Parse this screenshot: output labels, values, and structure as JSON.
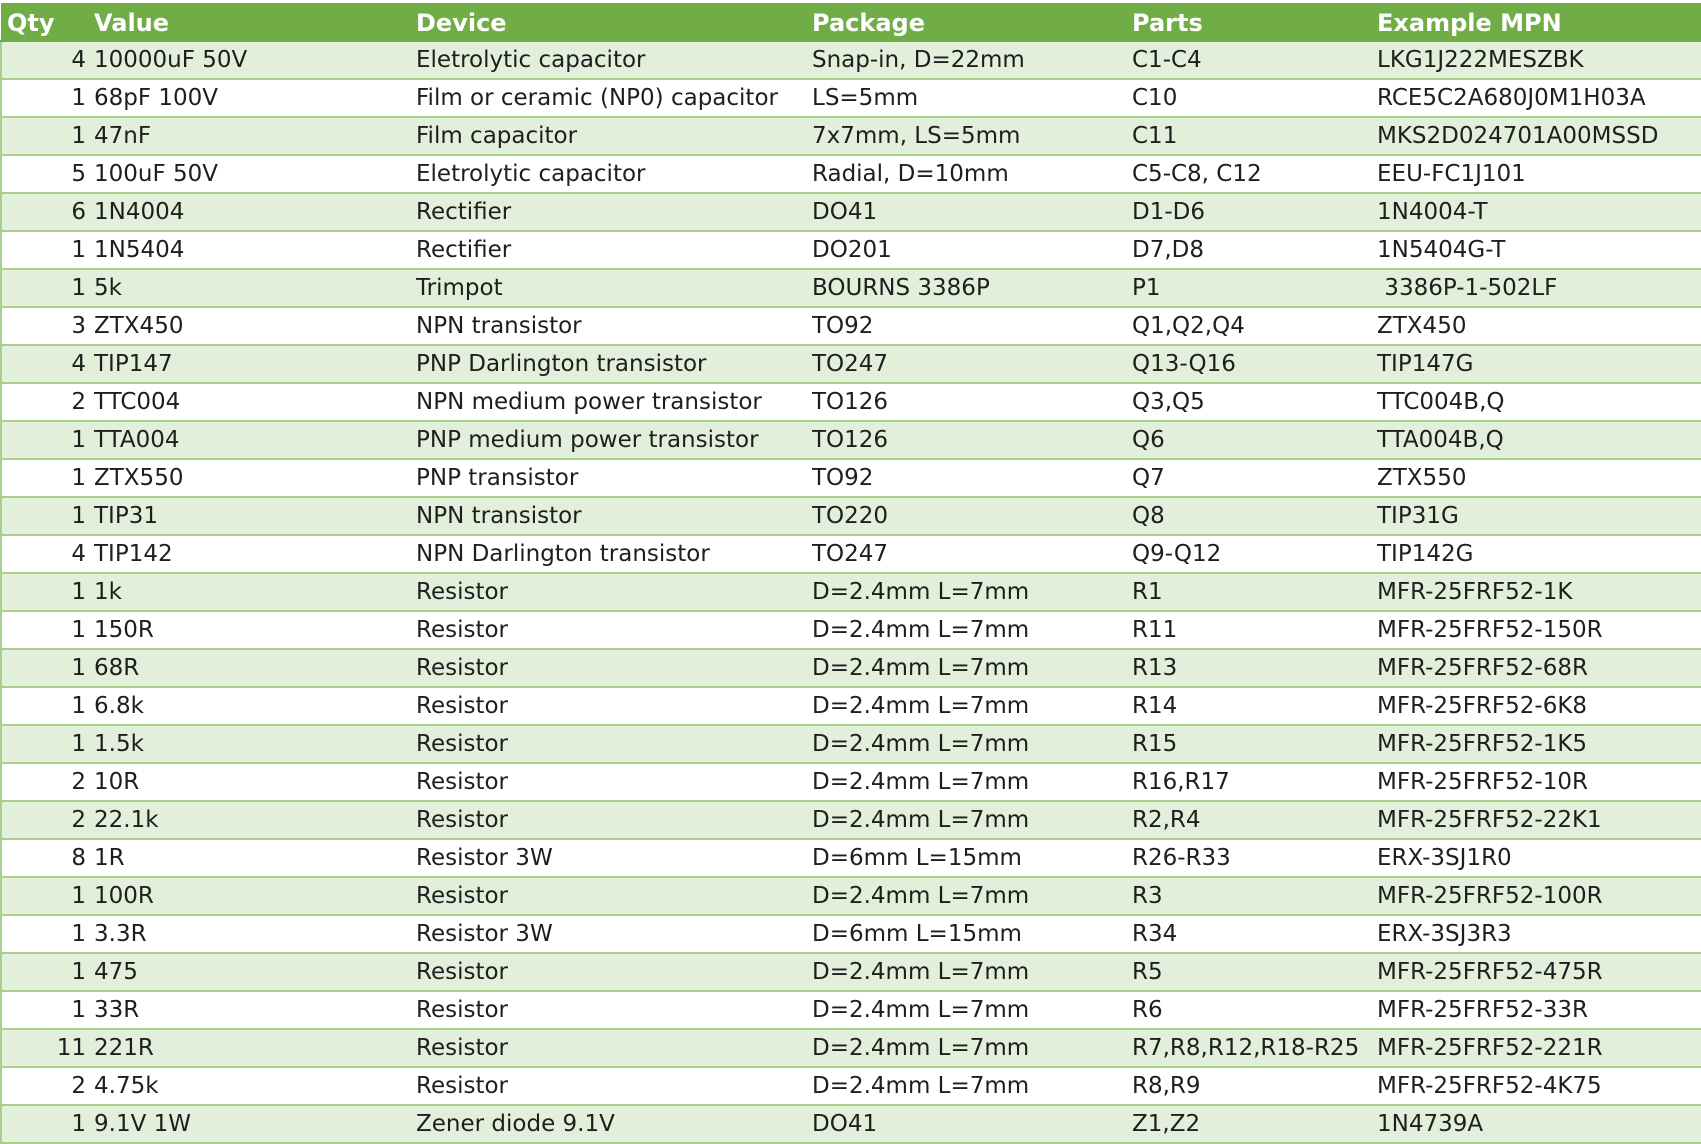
{
  "table": {
    "headers": {
      "qty": "Qty",
      "value": "Value",
      "device": "Device",
      "package": "Package",
      "parts": "Parts",
      "mpn": "Example MPN"
    },
    "rows": [
      {
        "qty": "4",
        "value": "10000uF 50V",
        "device": "Eletrolytic capacitor",
        "package": "Snap-in, D=22mm",
        "parts": "C1-C4",
        "mpn": "LKG1J222MESZBK"
      },
      {
        "qty": "1",
        "value": "68pF 100V",
        "device": "Film or ceramic (NP0) capacitor",
        "package": "LS=5mm",
        "parts": "C10",
        "mpn": "RCE5C2A680J0M1H03A"
      },
      {
        "qty": "1",
        "value": "47nF",
        "device": "Film capacitor",
        "package": "7x7mm, LS=5mm",
        "parts": "C11",
        "mpn": "MKS2D024701A00MSSD"
      },
      {
        "qty": "5",
        "value": "100uF 50V",
        "device": "Eletrolytic capacitor",
        "package": "Radial, D=10mm",
        "parts": "C5-C8, C12",
        "mpn": "EEU-FC1J101"
      },
      {
        "qty": "6",
        "value": "1N4004",
        "device": "Rectifier",
        "package": "DO41",
        "parts": "D1-D6",
        "mpn": "1N4004-T"
      },
      {
        "qty": "1",
        "value": "1N5404",
        "device": "Rectifier",
        "package": "DO201",
        "parts": "D7,D8",
        "mpn": "1N5404G-T"
      },
      {
        "qty": "1",
        "value": "5k",
        "device": "Trimpot",
        "package": "BOURNS 3386P",
        "parts": "P1",
        "mpn": " 3386P-1-502LF"
      },
      {
        "qty": "3",
        "value": "ZTX450",
        "device": "NPN transistor",
        "package": "TO92",
        "parts": "Q1,Q2,Q4",
        "mpn": "ZTX450"
      },
      {
        "qty": "4",
        "value": "TIP147",
        "device": "PNP Darlington transistor",
        "package": "TO247",
        "parts": "Q13-Q16",
        "mpn": "TIP147G"
      },
      {
        "qty": "2",
        "value": "TTC004",
        "device": "NPN medium power transistor",
        "package": "TO126",
        "parts": "Q3,Q5",
        "mpn": "TTC004B,Q"
      },
      {
        "qty": "1",
        "value": "TTA004",
        "device": "PNP medium power transistor",
        "package": "TO126",
        "parts": "Q6",
        "mpn": "TTA004B,Q"
      },
      {
        "qty": "1",
        "value": "ZTX550",
        "device": "PNP transistor",
        "package": "TO92",
        "parts": "Q7",
        "mpn": "ZTX550"
      },
      {
        "qty": "1",
        "value": "TIP31",
        "device": "NPN transistor",
        "package": "TO220",
        "parts": "Q8",
        "mpn": "TIP31G"
      },
      {
        "qty": "4",
        "value": "TIP142",
        "device": "NPN Darlington transistor",
        "package": "TO247",
        "parts": "Q9-Q12",
        "mpn": "TIP142G"
      },
      {
        "qty": "1",
        "value": "1k",
        "device": "Resistor",
        "package": "D=2.4mm L=7mm",
        "parts": "R1",
        "mpn": "MFR-25FRF52-1K"
      },
      {
        "qty": "1",
        "value": "150R",
        "device": "Resistor",
        "package": "D=2.4mm L=7mm",
        "parts": "R11",
        "mpn": "MFR-25FRF52-150R"
      },
      {
        "qty": "1",
        "value": "68R",
        "device": "Resistor",
        "package": "D=2.4mm L=7mm",
        "parts": "R13",
        "mpn": "MFR-25FRF52-68R"
      },
      {
        "qty": "1",
        "value": "6.8k",
        "device": "Resistor",
        "package": "D=2.4mm L=7mm",
        "parts": "R14",
        "mpn": "MFR-25FRF52-6K8"
      },
      {
        "qty": "1",
        "value": "1.5k",
        "device": "Resistor",
        "package": "D=2.4mm L=7mm",
        "parts": "R15",
        "mpn": "MFR-25FRF52-1K5"
      },
      {
        "qty": "2",
        "value": "10R",
        "device": "Resistor",
        "package": "D=2.4mm L=7mm",
        "parts": "R16,R17",
        "mpn": "MFR-25FRF52-10R"
      },
      {
        "qty": "2",
        "value": "22.1k",
        "device": "Resistor",
        "package": "D=2.4mm L=7mm",
        "parts": "R2,R4",
        "mpn": "MFR-25FRF52-22K1"
      },
      {
        "qty": "8",
        "value": "1R",
        "device": "Resistor 3W",
        "package": "D=6mm L=15mm",
        "parts": "R26-R33",
        "mpn": "ERX-3SJ1R0"
      },
      {
        "qty": "1",
        "value": "100R",
        "device": "Resistor",
        "package": "D=2.4mm L=7mm",
        "parts": "R3",
        "mpn": "MFR-25FRF52-100R"
      },
      {
        "qty": "1",
        "value": "3.3R",
        "device": "Resistor 3W",
        "package": "D=6mm L=15mm",
        "parts": "R34",
        "mpn": "ERX-3SJ3R3"
      },
      {
        "qty": "1",
        "value": "475",
        "device": "Resistor",
        "package": "D=2.4mm L=7mm",
        "parts": "R5",
        "mpn": "MFR-25FRF52-475R"
      },
      {
        "qty": "1",
        "value": "33R",
        "device": "Resistor",
        "package": "D=2.4mm L=7mm",
        "parts": "R6",
        "mpn": "MFR-25FRF52-33R"
      },
      {
        "qty": "11",
        "value": "221R",
        "device": "Resistor",
        "package": "D=2.4mm L=7mm",
        "parts": "R7,R8,R12,R18-R25",
        "mpn": "MFR-25FRF52-221R"
      },
      {
        "qty": "2",
        "value": "4.75k",
        "device": "Resistor",
        "package": "D=2.4mm L=7mm",
        "parts": "R8,R9",
        "mpn": "MFR-25FRF52-4K75"
      },
      {
        "qty": "1",
        "value": "9.1V 1W",
        "device": "Zener diode 9.1V",
        "package": "DO41",
        "parts": "Z1,Z2",
        "mpn": "1N4739A"
      }
    ]
  },
  "colors": {
    "header_bg": "#70ad47",
    "header_text": "#ffffff",
    "band_bg": "#e2efda",
    "row_border": "#a9d08e"
  }
}
